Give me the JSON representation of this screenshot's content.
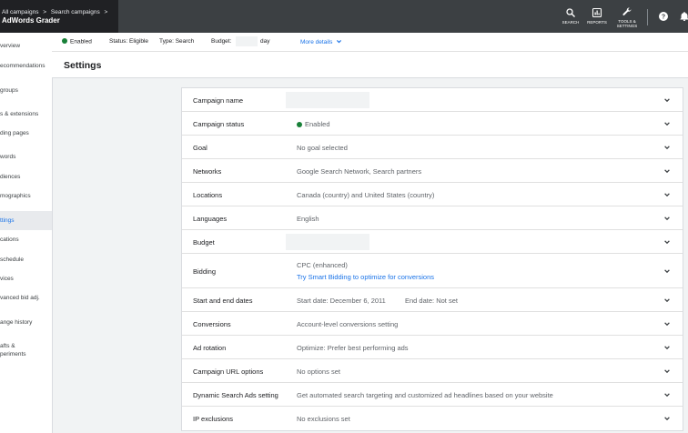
{
  "header": {
    "breadcrumb_1": "All campaigns",
    "breadcrumb_sep_1": ">",
    "breadcrumb_2": "Search campaigns",
    "breadcrumb_sep_2": ">",
    "account_name": "AdWords Grader",
    "tools": [
      {
        "label": "SEARCH",
        "icon": "search-icon"
      },
      {
        "label": "REPORTS",
        "icon": "reports-icon"
      },
      {
        "label": "TOOLS &",
        "label2": "SETTINGS",
        "icon": "wrench-icon"
      }
    ],
    "help_icon": "help-icon",
    "notifications_icon": "bell-icon"
  },
  "sidebar": {
    "items": [
      {
        "label": "verview"
      },
      {
        "label": "ecommendations"
      },
      {
        "label": "groups"
      },
      {
        "label": "s & extensions"
      },
      {
        "label": "ding pages"
      },
      {
        "label": "words"
      },
      {
        "label": "diences"
      },
      {
        "label": "mographics"
      },
      {
        "label": "ttings"
      },
      {
        "label": "cations"
      },
      {
        "label": "schedule"
      },
      {
        "label": "vices"
      },
      {
        "label": "vanced bid adj."
      },
      {
        "label": "ange history"
      },
      {
        "label": "afts &",
        "label2": "periments"
      }
    ],
    "active_index": 8
  },
  "status_bar": {
    "enabled": "Enabled",
    "status": "Status: Eligible",
    "type": "Type: Search",
    "budget_label": "Budget:",
    "budget_suffix": "day",
    "more_details": "More details"
  },
  "page": {
    "title": "Settings"
  },
  "settings": {
    "campaign_name": {
      "label": "Campaign name"
    },
    "campaign_status": {
      "label": "Campaign status",
      "value": "Enabled"
    },
    "goal": {
      "label": "Goal",
      "value": "No goal selected"
    },
    "networks": {
      "label": "Networks",
      "value": "Google Search Network, Search partners"
    },
    "locations": {
      "label": "Locations",
      "value": "Canada (country) and United States (country)"
    },
    "languages": {
      "label": "Languages",
      "value": "English"
    },
    "budget": {
      "label": "Budget"
    },
    "bidding": {
      "label": "Bidding",
      "value": "CPC (enhanced)",
      "link": "Try Smart Bidding to optimize for conversions"
    },
    "dates": {
      "label": "Start and end dates",
      "start": "Start date: December 6, 2011",
      "end": "End date: Not set"
    },
    "conversions": {
      "label": "Conversions",
      "value": "Account-level conversions setting"
    },
    "ad_rotation": {
      "label": "Ad rotation",
      "value": "Optimize: Prefer best performing ads"
    },
    "url_options": {
      "label": "Campaign URL options",
      "value": "No options set"
    },
    "dsa": {
      "label": "Dynamic Search Ads setting",
      "value": "Get automated search targeting and customized ad headlines based on your website"
    },
    "ip_exclusions": {
      "label": "IP exclusions",
      "value": "No exclusions set"
    }
  },
  "colors": {
    "topbar": "#3c4043",
    "accent": "#1a73e8",
    "enabled_green": "#188038"
  }
}
